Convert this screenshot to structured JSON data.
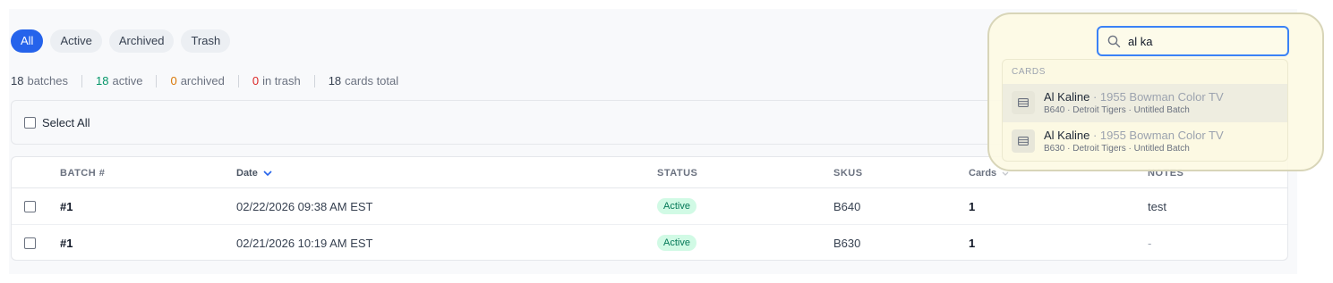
{
  "tabs": [
    {
      "label": "All",
      "active": true
    },
    {
      "label": "Active",
      "active": false
    },
    {
      "label": "Archived",
      "active": false
    },
    {
      "label": "Trash",
      "active": false
    }
  ],
  "stats": {
    "batches": {
      "value": "18",
      "label": "batches"
    },
    "active": {
      "value": "18",
      "label": "active"
    },
    "archived": {
      "value": "0",
      "label": "archived"
    },
    "trash": {
      "value": "0",
      "label": "in trash"
    },
    "cards": {
      "value": "18",
      "label": "cards total"
    }
  },
  "select_all": {
    "label": "Select All",
    "checked": false
  },
  "table": {
    "columns": {
      "batch": "BATCH #",
      "date": "Date",
      "status": "STATUS",
      "skus": "SKUS",
      "cards": "Cards",
      "notes": "NOTES"
    },
    "rows": [
      {
        "batch": "#1",
        "date": "02/22/2026 09:38 AM EST",
        "status": "Active",
        "skus": "B640",
        "cards": "1",
        "notes": "test"
      },
      {
        "batch": "#1",
        "date": "02/21/2026 10:19 AM EST",
        "status": "Active",
        "skus": "B630",
        "cards": "1",
        "notes": "-"
      }
    ]
  },
  "search": {
    "query": "al ka",
    "section_label": "CARDS",
    "results": [
      {
        "name": "Al Kaline",
        "set": "· 1955 Bowman Color TV",
        "meta": "B640 · Detroit Tigers · Untitled Batch"
      },
      {
        "name": "Al Kaline",
        "set": "· 1955 Bowman Color TV",
        "meta": "B630 · Detroit Tigers · Untitled Batch"
      }
    ]
  },
  "colors": {
    "accent": "#2563eb",
    "active_green": "#059669",
    "archived_orange": "#d97706",
    "trash_red": "#dc2626"
  }
}
